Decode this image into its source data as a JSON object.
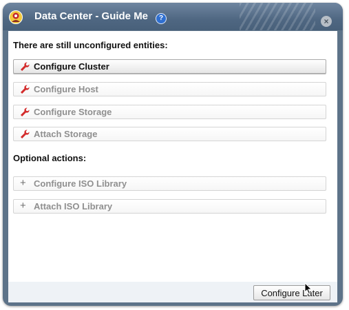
{
  "dialog": {
    "title": "Data Center - Guide Me",
    "help_icon": "help-icon",
    "close_icon": "close-icon"
  },
  "sections": {
    "required_title": "There are still unconfigured entities:",
    "optional_title": "Optional actions:"
  },
  "required_actions": [
    {
      "label": "Configure Cluster",
      "icon": "wrench-icon",
      "enabled": true
    },
    {
      "label": "Configure Host",
      "icon": "wrench-icon",
      "enabled": false
    },
    {
      "label": "Configure Storage",
      "icon": "wrench-icon",
      "enabled": false
    },
    {
      "label": "Attach Storage",
      "icon": "wrench-icon",
      "enabled": false
    }
  ],
  "optional_actions": [
    {
      "label": "Configure ISO Library",
      "icon": "plus-icon",
      "enabled": false
    },
    {
      "label": "Attach ISO Library",
      "icon": "plus-icon",
      "enabled": false
    }
  ],
  "footer": {
    "configure_later_label": "Configure Later"
  },
  "colors": {
    "titlebar": "#4f6782",
    "wrench": "#d32b2b",
    "enabled_text": "#111111",
    "disabled_text": "#8f8f8f"
  }
}
